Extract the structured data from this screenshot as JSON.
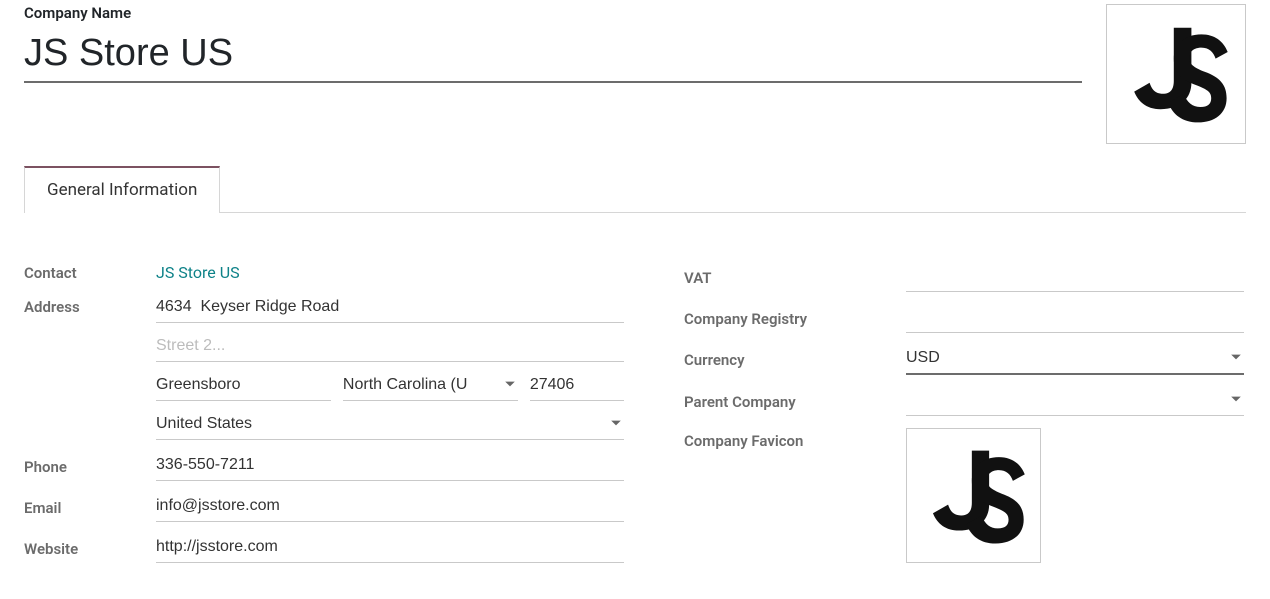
{
  "header": {
    "title_label": "Company Name",
    "company_name": "JS Store US"
  },
  "tabs": [
    {
      "label": "General Information",
      "active": true
    }
  ],
  "left": {
    "contact_label": "Contact",
    "contact_value": "JS Store US",
    "address_label": "Address",
    "street1": "4634  Keyser Ridge Road",
    "street2_placeholder": "Street 2...",
    "street2": "",
    "city": "Greensboro",
    "state": "North Carolina (U",
    "zip": "27406",
    "country": "United States",
    "phone_label": "Phone",
    "phone": "336-550-7211",
    "email_label": "Email",
    "email": "info@jsstore.com",
    "website_label": "Website",
    "website": "http://jsstore.com"
  },
  "right": {
    "vat_label": "VAT",
    "vat": "",
    "registry_label": "Company Registry",
    "registry": "",
    "currency_label": "Currency",
    "currency": "USD",
    "parent_label": "Parent Company",
    "parent": "",
    "favicon_label": "Company Favicon"
  }
}
